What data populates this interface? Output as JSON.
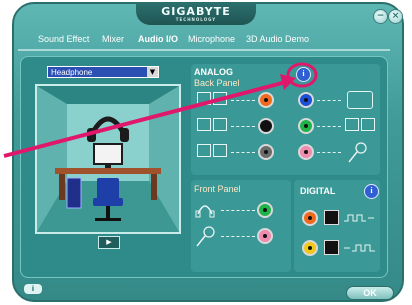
{
  "window": {
    "brand": "GIGABYTE",
    "brand_sub": "TECHNOLOGY",
    "minimize_glyph": "−",
    "close_glyph": "×"
  },
  "tabs": [
    {
      "label": "Sound Effect"
    },
    {
      "label": "Mixer"
    },
    {
      "label": "Audio I/O",
      "active": true
    },
    {
      "label": "Microphone"
    },
    {
      "label": "3D Audio Demo"
    }
  ],
  "device_select": {
    "value": "Headphone"
  },
  "play_glyph": "▶",
  "analog": {
    "title": "ANALOG",
    "back_panel": "Back Panel",
    "front_panel": "Front Panel",
    "info_glyph": "i"
  },
  "digital": {
    "title": "DIGITAL",
    "info_glyph": "i"
  },
  "footer": {
    "help_glyph": "i",
    "ok_label": "OK"
  },
  "colors": {
    "accent_arrow": "#e0186c",
    "jack_orange": "#f06a1e",
    "jack_black": "#111111",
    "jack_gray": "#6b6b6b",
    "jack_blue": "#1e4fd8",
    "jack_green": "#1fb34a",
    "jack_pink": "#f08bb0",
    "dropdown_bg": "#2c4fb3"
  },
  "icons": [
    "info-icon",
    "speaker-icon",
    "headphone-icon",
    "microphone-icon",
    "monitor-icon",
    "optical-port-icon",
    "coaxial-port-icon",
    "play-icon"
  ]
}
